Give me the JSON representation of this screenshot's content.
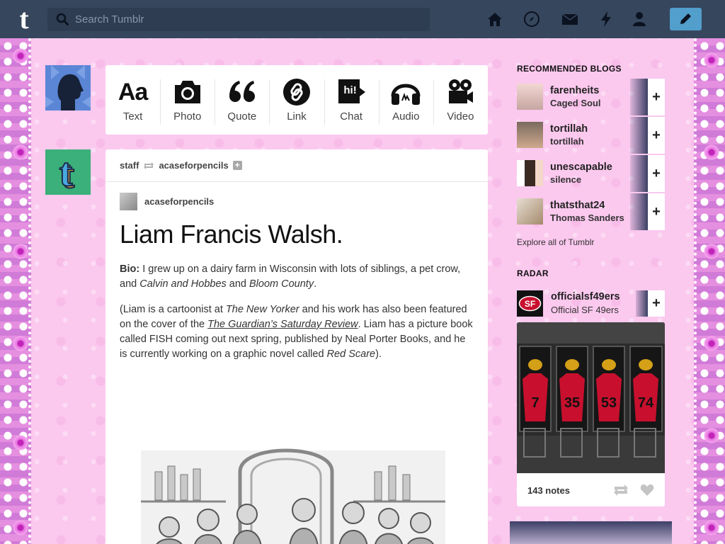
{
  "header": {
    "search_placeholder": "Search Tumblr",
    "nav_icons": [
      "home-icon",
      "explore-compass-icon",
      "inbox-mail-icon",
      "activity-lightning-icon",
      "account-person-icon"
    ],
    "compose_icon": "pencil-icon",
    "colors": {
      "bar": "#36465d",
      "search": "#2e3d52",
      "compose": "#529ecc"
    }
  },
  "post_types": [
    {
      "label": "Text",
      "glyph": "Aa"
    },
    {
      "label": "Photo"
    },
    {
      "label": "Quote"
    },
    {
      "label": "Link"
    },
    {
      "label": "Chat",
      "glyph": "hi!"
    },
    {
      "label": "Audio"
    },
    {
      "label": "Video"
    }
  ],
  "post": {
    "reblogger": "staff",
    "source": "acaseforpencils",
    "author": "acaseforpencils",
    "title": "Liam Francis Walsh.",
    "bio_label": "Bio:",
    "bio_text_1": " I grew up on a dairy farm in Wisconsin with lots of siblings, a pet crow, and ",
    "bio_italic_1": "Calvin and Hobbes",
    "bio_text_2": " and ",
    "bio_italic_2": "Bloom County",
    "bio_text_3": ".",
    "p2_text_1": "(Liam is a cartoonist at ",
    "p2_italic_1": "The New Yorker",
    "p2_text_2": " and his work has also been featured on the cover of the ",
    "p2_link": "The Guardian’s Saturday Review",
    "p2_text_3": ". Liam has a picture book called FISH coming out next spring, published by Neal Porter Books, and he is currently working on a graphic novel called ",
    "p2_italic_2": "Red Scare",
    "p2_text_4": ")."
  },
  "sidebar": {
    "recommended_heading": "RECOMMENDED BLOGS",
    "recommended": [
      {
        "name": "farenheits",
        "title": "Caged Soul"
      },
      {
        "name": "tortillah",
        "title": "tortillah"
      },
      {
        "name": "unescapable",
        "title": "silence"
      },
      {
        "name": "thatsthat24",
        "title": "Thomas Sanders"
      }
    ],
    "follow_symbol": "+",
    "explore_label": "Explore all of Tumblr",
    "radar_heading": "RADAR",
    "radar_blog": {
      "name": "officialsf49ers",
      "title": "Official SF 49ers"
    },
    "radar_jersey_numbers": [
      "7",
      "35",
      "53",
      "74"
    ],
    "radar_notes": "143 notes"
  }
}
